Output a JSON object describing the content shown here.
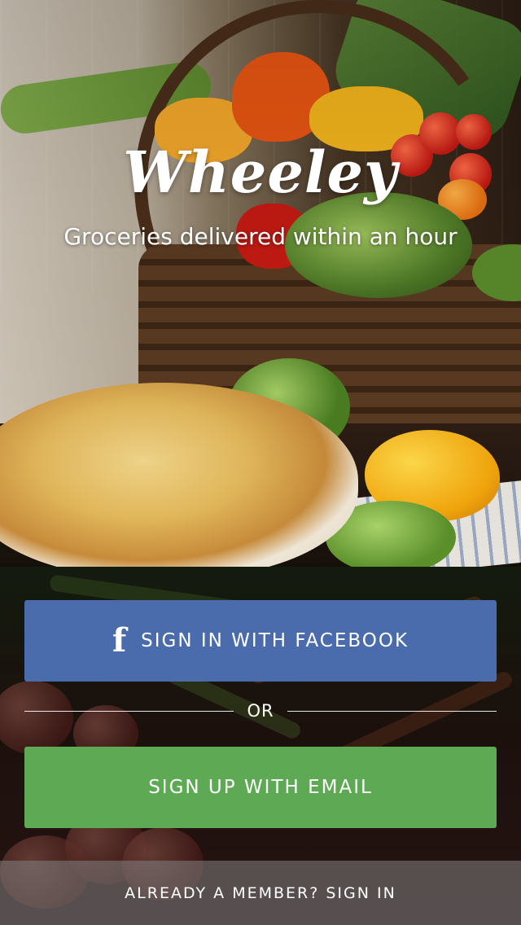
{
  "brand": {
    "logo_text": "Wheeley",
    "tagline": "Groceries delivered within an hour"
  },
  "actions": {
    "facebook_label": "SIGN IN WITH FACEBOOK",
    "or_label": "OR",
    "email_label": "SIGN UP WITH EMAIL",
    "member_label": "ALREADY A MEMBER? SIGN IN"
  },
  "icons": {
    "facebook_icon": "facebook-logo",
    "facebook_glyph": "f"
  },
  "colors": {
    "facebook_blue": "#4a6cad",
    "email_green": "#5ea953",
    "text": "#ffffff"
  }
}
